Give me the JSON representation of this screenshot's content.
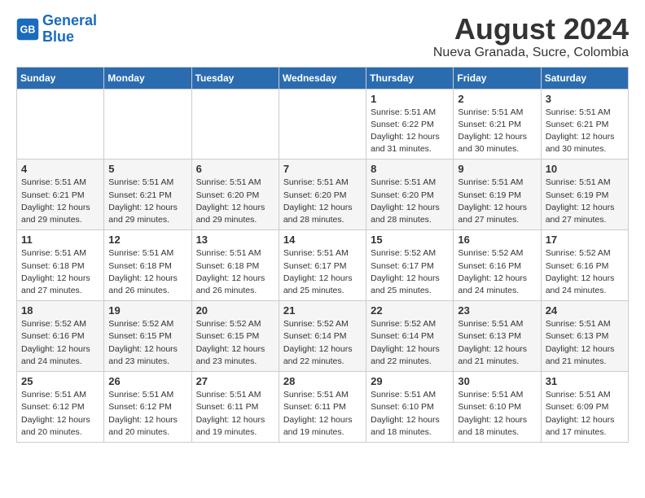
{
  "logo": {
    "text_general": "General",
    "text_blue": "Blue"
  },
  "header": {
    "title": "August 2024",
    "subtitle": "Nueva Granada, Sucre, Colombia"
  },
  "weekdays": [
    "Sunday",
    "Monday",
    "Tuesday",
    "Wednesday",
    "Thursday",
    "Friday",
    "Saturday"
  ],
  "weeks": [
    [
      {
        "day": "",
        "info": ""
      },
      {
        "day": "",
        "info": ""
      },
      {
        "day": "",
        "info": ""
      },
      {
        "day": "",
        "info": ""
      },
      {
        "day": "1",
        "info": "Sunrise: 5:51 AM\nSunset: 6:22 PM\nDaylight: 12 hours\nand 31 minutes."
      },
      {
        "day": "2",
        "info": "Sunrise: 5:51 AM\nSunset: 6:21 PM\nDaylight: 12 hours\nand 30 minutes."
      },
      {
        "day": "3",
        "info": "Sunrise: 5:51 AM\nSunset: 6:21 PM\nDaylight: 12 hours\nand 30 minutes."
      }
    ],
    [
      {
        "day": "4",
        "info": "Sunrise: 5:51 AM\nSunset: 6:21 PM\nDaylight: 12 hours\nand 29 minutes."
      },
      {
        "day": "5",
        "info": "Sunrise: 5:51 AM\nSunset: 6:21 PM\nDaylight: 12 hours\nand 29 minutes."
      },
      {
        "day": "6",
        "info": "Sunrise: 5:51 AM\nSunset: 6:20 PM\nDaylight: 12 hours\nand 29 minutes."
      },
      {
        "day": "7",
        "info": "Sunrise: 5:51 AM\nSunset: 6:20 PM\nDaylight: 12 hours\nand 28 minutes."
      },
      {
        "day": "8",
        "info": "Sunrise: 5:51 AM\nSunset: 6:20 PM\nDaylight: 12 hours\nand 28 minutes."
      },
      {
        "day": "9",
        "info": "Sunrise: 5:51 AM\nSunset: 6:19 PM\nDaylight: 12 hours\nand 27 minutes."
      },
      {
        "day": "10",
        "info": "Sunrise: 5:51 AM\nSunset: 6:19 PM\nDaylight: 12 hours\nand 27 minutes."
      }
    ],
    [
      {
        "day": "11",
        "info": "Sunrise: 5:51 AM\nSunset: 6:18 PM\nDaylight: 12 hours\nand 27 minutes."
      },
      {
        "day": "12",
        "info": "Sunrise: 5:51 AM\nSunset: 6:18 PM\nDaylight: 12 hours\nand 26 minutes."
      },
      {
        "day": "13",
        "info": "Sunrise: 5:51 AM\nSunset: 6:18 PM\nDaylight: 12 hours\nand 26 minutes."
      },
      {
        "day": "14",
        "info": "Sunrise: 5:51 AM\nSunset: 6:17 PM\nDaylight: 12 hours\nand 25 minutes."
      },
      {
        "day": "15",
        "info": "Sunrise: 5:52 AM\nSunset: 6:17 PM\nDaylight: 12 hours\nand 25 minutes."
      },
      {
        "day": "16",
        "info": "Sunrise: 5:52 AM\nSunset: 6:16 PM\nDaylight: 12 hours\nand 24 minutes."
      },
      {
        "day": "17",
        "info": "Sunrise: 5:52 AM\nSunset: 6:16 PM\nDaylight: 12 hours\nand 24 minutes."
      }
    ],
    [
      {
        "day": "18",
        "info": "Sunrise: 5:52 AM\nSunset: 6:16 PM\nDaylight: 12 hours\nand 24 minutes."
      },
      {
        "day": "19",
        "info": "Sunrise: 5:52 AM\nSunset: 6:15 PM\nDaylight: 12 hours\nand 23 minutes."
      },
      {
        "day": "20",
        "info": "Sunrise: 5:52 AM\nSunset: 6:15 PM\nDaylight: 12 hours\nand 23 minutes."
      },
      {
        "day": "21",
        "info": "Sunrise: 5:52 AM\nSunset: 6:14 PM\nDaylight: 12 hours\nand 22 minutes."
      },
      {
        "day": "22",
        "info": "Sunrise: 5:52 AM\nSunset: 6:14 PM\nDaylight: 12 hours\nand 22 minutes."
      },
      {
        "day": "23",
        "info": "Sunrise: 5:51 AM\nSunset: 6:13 PM\nDaylight: 12 hours\nand 21 minutes."
      },
      {
        "day": "24",
        "info": "Sunrise: 5:51 AM\nSunset: 6:13 PM\nDaylight: 12 hours\nand 21 minutes."
      }
    ],
    [
      {
        "day": "25",
        "info": "Sunrise: 5:51 AM\nSunset: 6:12 PM\nDaylight: 12 hours\nand 20 minutes."
      },
      {
        "day": "26",
        "info": "Sunrise: 5:51 AM\nSunset: 6:12 PM\nDaylight: 12 hours\nand 20 minutes."
      },
      {
        "day": "27",
        "info": "Sunrise: 5:51 AM\nSunset: 6:11 PM\nDaylight: 12 hours\nand 19 minutes."
      },
      {
        "day": "28",
        "info": "Sunrise: 5:51 AM\nSunset: 6:11 PM\nDaylight: 12 hours\nand 19 minutes."
      },
      {
        "day": "29",
        "info": "Sunrise: 5:51 AM\nSunset: 6:10 PM\nDaylight: 12 hours\nand 18 minutes."
      },
      {
        "day": "30",
        "info": "Sunrise: 5:51 AM\nSunset: 6:10 PM\nDaylight: 12 hours\nand 18 minutes."
      },
      {
        "day": "31",
        "info": "Sunrise: 5:51 AM\nSunset: 6:09 PM\nDaylight: 12 hours\nand 17 minutes."
      }
    ]
  ]
}
